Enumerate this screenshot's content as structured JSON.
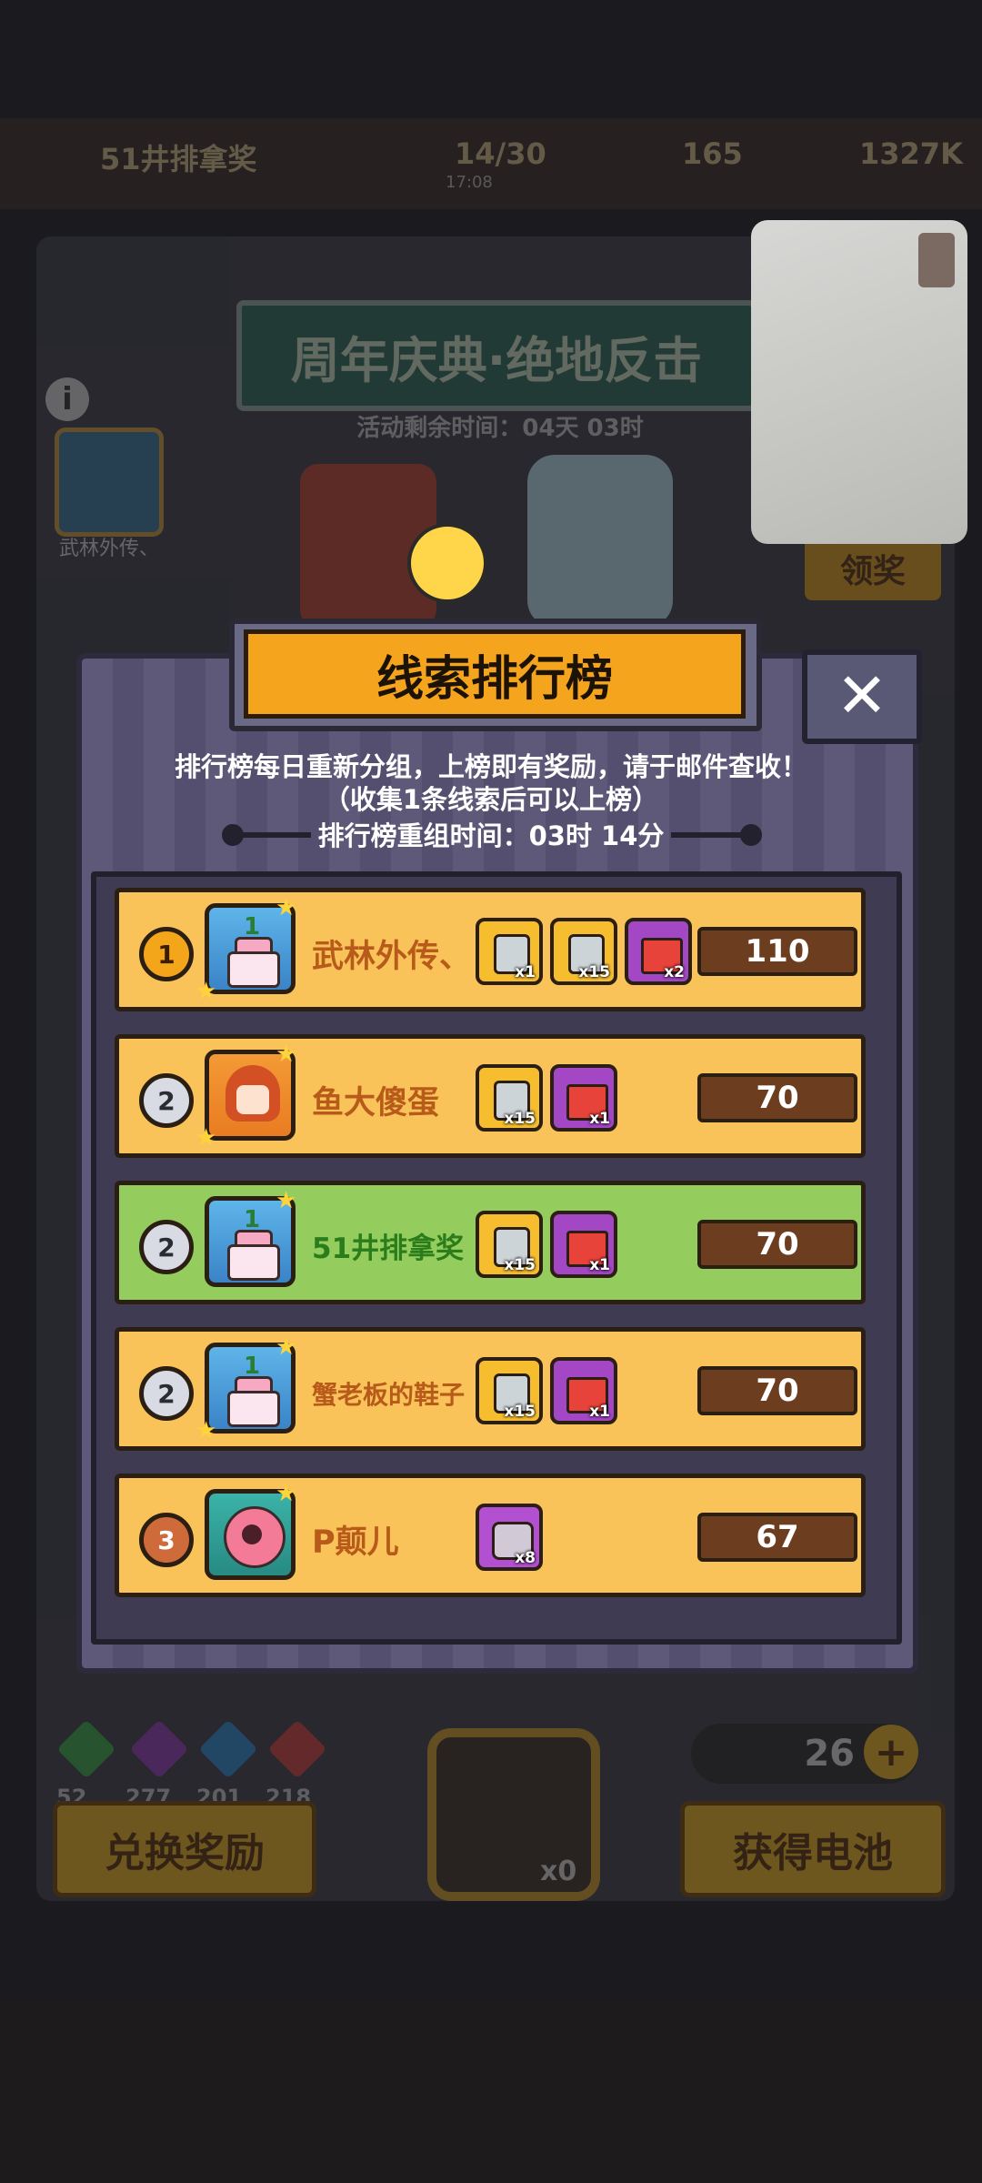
{
  "background": {
    "player_name": "51井排拿奖",
    "counter": "14/30",
    "counter_sub": "17:08",
    "currency_1": "165",
    "currency_2": "1327K",
    "event_banner": "周年庆典·绝地反击",
    "event_timer": "活动剩余时间：04天 03时",
    "avatar_label": "武林外传、",
    "claim_button": "领奖",
    "gems": [
      "52",
      "277",
      "201",
      "218"
    ],
    "redeem_button": "兑换奖励",
    "battery_count": "26",
    "get_battery_button": "获得电池",
    "lock_count": "x0",
    "colors": {
      "gem_green": "#3bb04a",
      "gem_purple": "#9a3fbf",
      "gem_blue": "#2f8fd8",
      "gem_red": "#d84040"
    }
  },
  "modal": {
    "title": "线索排行榜",
    "close_icon": "close-icon",
    "description_line1": "排行榜每日重新分组，上榜即有奖励，请于邮件查收！",
    "description_line2": "（收集1条线索后可以上榜）",
    "reset_label": "排行榜重组时间：03时 14分",
    "rows": [
      {
        "rank": "1",
        "name": "武林外传、",
        "avatar": "cake",
        "highlight": false,
        "score": "110",
        "rewards": [
          {
            "type": "chest",
            "qty": "x1"
          },
          {
            "type": "chest",
            "qty": "x15"
          },
          {
            "type": "gift",
            "qty": "x2"
          }
        ]
      },
      {
        "rank": "2",
        "name": "鱼大傻蛋",
        "avatar": "girl",
        "highlight": false,
        "score": "70",
        "rewards": [
          {
            "type": "chest",
            "qty": "x15"
          },
          {
            "type": "gift",
            "qty": "x1"
          }
        ]
      },
      {
        "rank": "2",
        "name": "51井排拿奖",
        "avatar": "cake",
        "highlight": true,
        "score": "70",
        "rewards": [
          {
            "type": "chest",
            "qty": "x15"
          },
          {
            "type": "gift",
            "qty": "x1"
          }
        ]
      },
      {
        "rank": "2",
        "name": "蟹老板的鞋子",
        "avatar": "cake",
        "highlight": false,
        "score": "70",
        "rewards": [
          {
            "type": "chest",
            "qty": "x15"
          },
          {
            "type": "gift",
            "qty": "x1"
          }
        ]
      },
      {
        "rank": "3",
        "name": "P颠儿",
        "avatar": "flower",
        "highlight": false,
        "score": "67",
        "rewards": [
          {
            "type": "puzzle",
            "qty": "x8"
          }
        ]
      }
    ],
    "colors": {
      "row_gold": "#f9c35a",
      "row_highlight": "#94cd5e",
      "title_orange": "#f5a51d",
      "score_bg": "#6d3d1f"
    }
  }
}
